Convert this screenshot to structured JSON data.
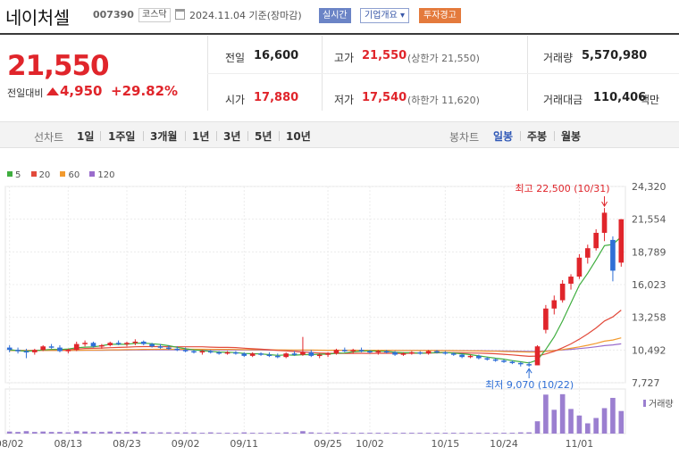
{
  "header": {
    "stock_name": "네이처셀",
    "stock_code": "007390",
    "market": "코스닥",
    "date_text": "2024.11.04 기준(장마감)",
    "btn_realtime": "실시간",
    "btn_company": "기업개요 ▾",
    "btn_warning": "투자경고"
  },
  "summary": {
    "current_price": "21,550",
    "change_label": "전일대비",
    "change_value": "4,950",
    "change_pct": "+29.82%",
    "prev_label": "전일",
    "prev_value": "16,600",
    "open_label": "시가",
    "open_value": "17,880",
    "high_label": "고가",
    "high_value": "21,550",
    "high_sub": "(상한가 21,550)",
    "low_label": "저가",
    "low_value": "17,540",
    "low_sub": "(하한가 11,620)",
    "volume_label": "거래량",
    "volume_value": "5,570,980",
    "amount_label": "거래대금",
    "amount_value": "110,406",
    "amount_unit": "백만",
    "up_color": "#e0252b"
  },
  "period_bar": {
    "line_label": "선차트",
    "line_items": [
      "1일",
      "1주일",
      "3개월",
      "1년",
      "3년",
      "5년",
      "10년"
    ],
    "candle_label": "봉차트",
    "candle_items": [
      "일봉",
      "주봉",
      "월봉"
    ],
    "active_candle": "일봉"
  },
  "chart_data": {
    "type": "candlestick",
    "legend": [
      {
        "name": "5",
        "color": "#3fae3f"
      },
      {
        "name": "20",
        "color": "#e24a3b"
      },
      {
        "name": "60",
        "color": "#f29a2e"
      },
      {
        "name": "120",
        "color": "#9a6ccc"
      }
    ],
    "y_ticks": [
      "24,320",
      "21,554",
      "18,789",
      "16,023",
      "13,258",
      "10,492",
      "7,727"
    ],
    "ylim": [
      7727,
      24320
    ],
    "x_ticks": [
      "08/02",
      "08/13",
      "08/23",
      "09/02",
      "09/11",
      "09/25",
      "10/02",
      "10/15",
      "10/24",
      "11/01"
    ],
    "volume_label": "거래량",
    "high_annotation": "최고 22,500 (10/31)",
    "low_annotation": "최저 9,070 (10/22)",
    "candles": [
      [
        10700,
        10900,
        10300,
        10500
      ],
      [
        10500,
        10700,
        10200,
        10400
      ],
      [
        10400,
        10600,
        9800,
        10300
      ],
      [
        10300,
        10600,
        10100,
        10500
      ],
      [
        10500,
        10900,
        10400,
        10800
      ],
      [
        10800,
        11000,
        10600,
        10700
      ],
      [
        10700,
        10900,
        10300,
        10400
      ],
      [
        10400,
        10600,
        10200,
        10500
      ],
      [
        10500,
        11200,
        10400,
        11000
      ],
      [
        11000,
        11300,
        10800,
        11100
      ],
      [
        11100,
        11200,
        10700,
        10800
      ],
      [
        10800,
        11000,
        10600,
        10900
      ],
      [
        10900,
        11200,
        10800,
        11100
      ],
      [
        11100,
        11300,
        10900,
        11000
      ],
      [
        11000,
        11200,
        10800,
        11100
      ],
      [
        11100,
        11400,
        10900,
        11200
      ],
      [
        11200,
        11300,
        10900,
        11000
      ],
      [
        11000,
        11100,
        10700,
        10800
      ],
      [
        10800,
        11000,
        10600,
        10700
      ],
      [
        10700,
        10900,
        10500,
        10600
      ],
      [
        10600,
        10800,
        10400,
        10500
      ],
      [
        10500,
        10700,
        10300,
        10400
      ],
      [
        10400,
        10500,
        10200,
        10300
      ],
      [
        10300,
        10500,
        10100,
        10400
      ],
      [
        10400,
        10500,
        10200,
        10300
      ],
      [
        10300,
        10400,
        10100,
        10200
      ],
      [
        10200,
        10400,
        10100,
        10300
      ],
      [
        10300,
        10400,
        10100,
        10200
      ],
      [
        10200,
        10300,
        9900,
        10000
      ],
      [
        10000,
        10300,
        9900,
        10200
      ],
      [
        10200,
        10300,
        10000,
        10100
      ],
      [
        10100,
        10300,
        9900,
        10000
      ],
      [
        10000,
        10200,
        9800,
        9900
      ],
      [
        9900,
        10300,
        9800,
        10200
      ],
      [
        10200,
        10400,
        10000,
        10100
      ],
      [
        10100,
        11600,
        10000,
        10300
      ],
      [
        10300,
        10500,
        9900,
        10000
      ],
      [
        10000,
        10200,
        9800,
        10100
      ],
      [
        10100,
        10300,
        9900,
        10200
      ],
      [
        10200,
        10600,
        10100,
        10500
      ],
      [
        10500,
        10700,
        10300,
        10400
      ],
      [
        10400,
        10600,
        10200,
        10500
      ],
      [
        10500,
        10700,
        10300,
        10400
      ],
      [
        10400,
        10500,
        10200,
        10300
      ],
      [
        10300,
        10500,
        10100,
        10400
      ],
      [
        10400,
        10500,
        10200,
        10300
      ],
      [
        10300,
        10400,
        10000,
        10100
      ],
      [
        10100,
        10300,
        10000,
        10200
      ],
      [
        10200,
        10400,
        10100,
        10300
      ],
      [
        10300,
        10400,
        10100,
        10200
      ],
      [
        10200,
        10500,
        10100,
        10400
      ],
      [
        10400,
        10500,
        10200,
        10300
      ],
      [
        10300,
        10400,
        10100,
        10200
      ],
      [
        10200,
        10300,
        10000,
        10100
      ],
      [
        10100,
        10200,
        9800,
        9900
      ],
      [
        9900,
        10100,
        9800,
        10000
      ],
      [
        10000,
        10100,
        9700,
        9800
      ],
      [
        9800,
        9900,
        9600,
        9700
      ],
      [
        9700,
        9800,
        9500,
        9600
      ],
      [
        9600,
        9700,
        9400,
        9500
      ],
      [
        9500,
        9600,
        9300,
        9400
      ],
      [
        9400,
        9500,
        9100,
        9300
      ],
      [
        9300,
        9500,
        9070,
        9200
      ],
      [
        9200,
        10900,
        9200,
        10800
      ],
      [
        12200,
        14300,
        11900,
        14000
      ],
      [
        14000,
        15100,
        13500,
        14700
      ],
      [
        14700,
        16400,
        14500,
        16100
      ],
      [
        16100,
        16900,
        15600,
        16700
      ],
      [
        16700,
        18600,
        16500,
        18300
      ],
      [
        18300,
        19400,
        17800,
        19100
      ],
      [
        19100,
        20700,
        18900,
        20400
      ],
      [
        20400,
        22500,
        19700,
        22100
      ],
      [
        19800,
        20100,
        16300,
        17200
      ],
      [
        17880,
        21550,
        17540,
        21550
      ]
    ],
    "volume": [
      0.05,
      0.04,
      0.06,
      0.04,
      0.05,
      0.04,
      0.04,
      0.03,
      0.06,
      0.05,
      0.04,
      0.04,
      0.05,
      0.04,
      0.04,
      0.05,
      0.04,
      0.03,
      0.03,
      0.03,
      0.03,
      0.03,
      0.03,
      0.02,
      0.03,
      0.02,
      0.02,
      0.02,
      0.03,
      0.02,
      0.02,
      0.02,
      0.02,
      0.03,
      0.02,
      0.06,
      0.03,
      0.02,
      0.02,
      0.03,
      0.02,
      0.02,
      0.02,
      0.02,
      0.02,
      0.02,
      0.02,
      0.02,
      0.02,
      0.02,
      0.02,
      0.02,
      0.02,
      0.02,
      0.02,
      0.02,
      0.02,
      0.02,
      0.02,
      0.02,
      0.02,
      0.03,
      0.03,
      0.3,
      0.95,
      0.58,
      0.96,
      0.6,
      0.44,
      0.25,
      0.38,
      0.62,
      0.87,
      0.55
    ]
  }
}
